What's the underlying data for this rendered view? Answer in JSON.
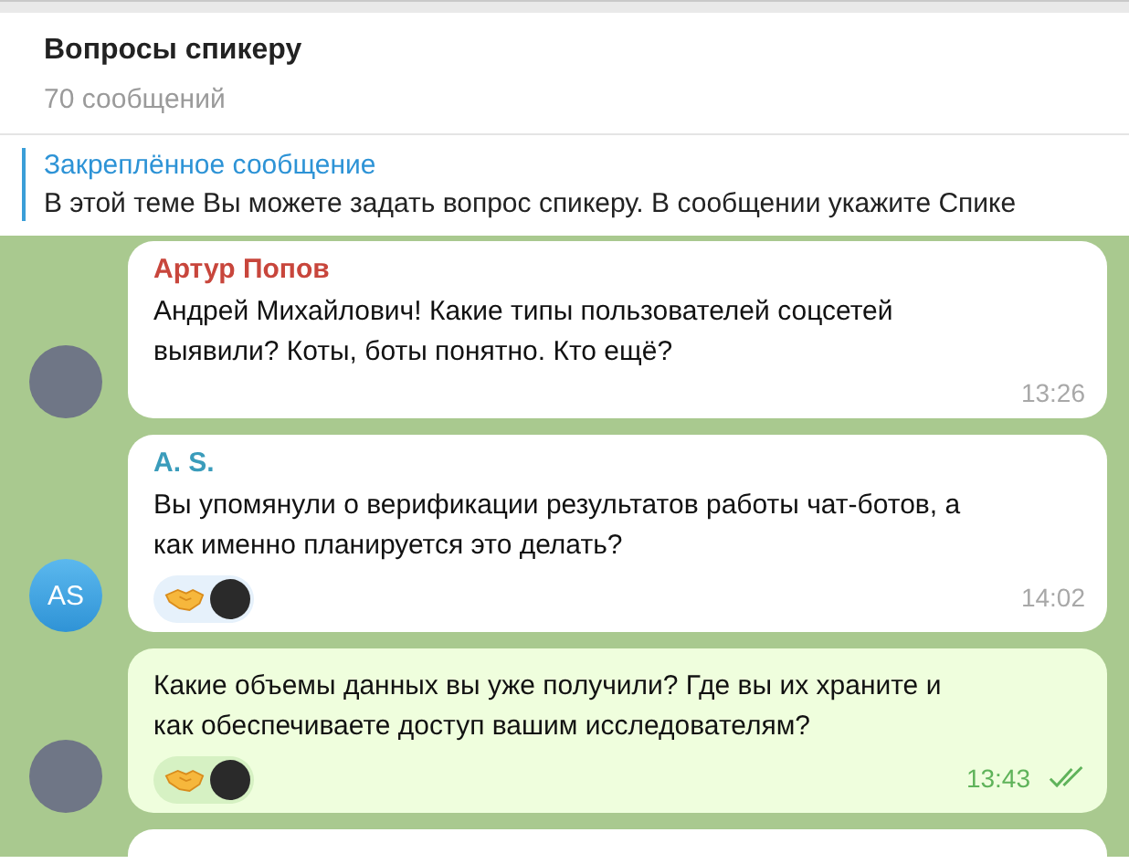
{
  "header": {
    "title": "Вопросы спикеру",
    "subtitle": "70 сообщений"
  },
  "pinned": {
    "label": "Закреплённое сообщение",
    "text": "В этой теме Вы можете задать вопрос спикеру. В сообщении укажите Спике"
  },
  "messages": [
    {
      "outgoing": false,
      "author": "Артур Попов",
      "color": "#c8463c",
      "avatar": {
        "kind": "photo"
      },
      "text": "Андрей Михайлович! Какие типы пользователей соцсетей выявили? Коты, боты понятно. Кто ещё?",
      "reacted": false,
      "time": "13:26",
      "read": false
    },
    {
      "outgoing": false,
      "author": "A. S.",
      "color": "#3a9cbb",
      "avatar": {
        "kind": "initials",
        "initials": "AS"
      },
      "text": "Вы упомянули о верификации результатов работы чат-ботов, а как именно планируется это делать?",
      "reacted": true,
      "time": "14:02",
      "read": false
    },
    {
      "outgoing": true,
      "avatar": {
        "kind": "photo"
      },
      "text": "Какие объемы  данных вы уже получили? Где вы их храните и как обеспечиваете доступ вашим исследователям?",
      "reacted": true,
      "time": "13:43",
      "read": true
    }
  ],
  "more_below": true
}
